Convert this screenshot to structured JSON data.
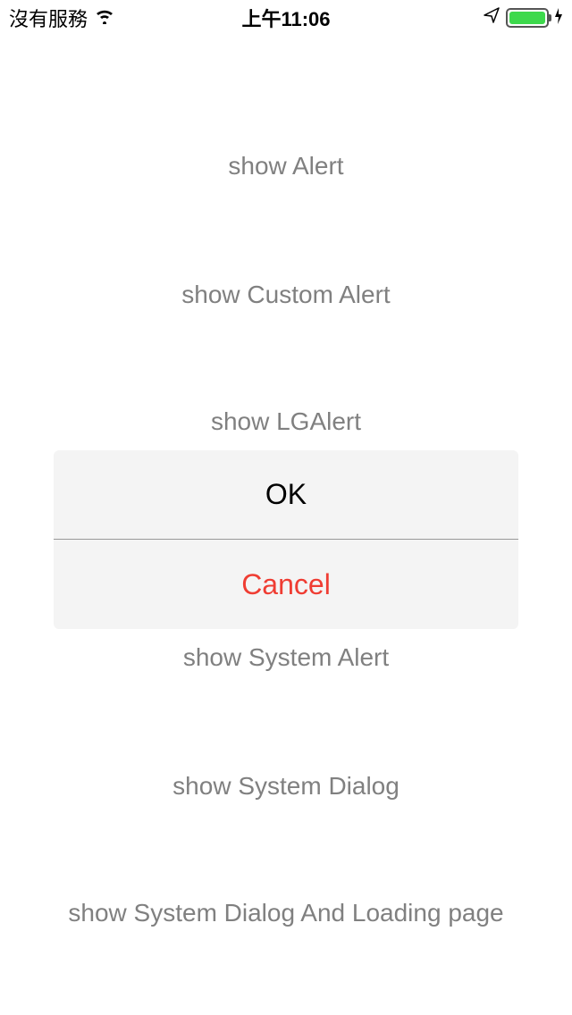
{
  "status": {
    "service_text": "沒有服務",
    "time": "上午11:06"
  },
  "buttons": {
    "show_alert": "show Alert",
    "show_custom_alert": "show Custom Alert",
    "show_lgalert": "show LGAlert",
    "show_system_alert": "show System Alert",
    "show_system_dialog": "show System Dialog",
    "show_system_dialog_loading": "show System Dialog And Loading page"
  },
  "alert": {
    "ok": "OK",
    "cancel": "Cancel"
  },
  "colors": {
    "link_gray": "#808080",
    "cancel_red": "#ef3d33",
    "battery_green": "#3dd94c"
  }
}
